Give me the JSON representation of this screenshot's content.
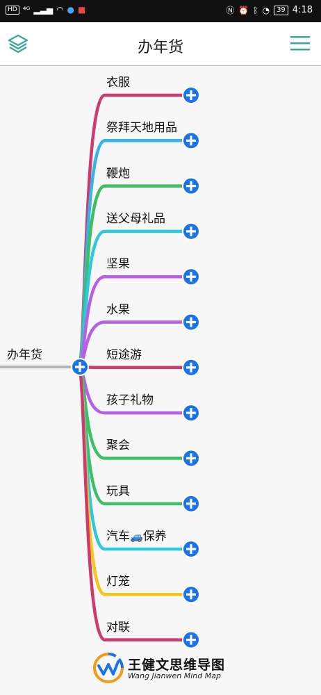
{
  "status_bar": {
    "left_indicators": [
      "HD",
      "4G",
      "signal",
      "wifi",
      "app-notification",
      "app-notification-2"
    ],
    "battery": "39",
    "time": "4:18"
  },
  "app_bar": {
    "title": "办年货",
    "left_icon": "layers-icon",
    "right_icon": "menu-icon"
  },
  "mindmap": {
    "root": {
      "label": "办年货",
      "color": "#b5b5b5"
    },
    "branches": [
      {
        "label": "衣服",
        "color": "#cc3b6e"
      },
      {
        "label": "祭拜天地用品",
        "color": "#36b4ea"
      },
      {
        "label": "鞭炮",
        "color": "#3fbf63"
      },
      {
        "label": "送父母礼品",
        "color": "#2ec9df"
      },
      {
        "label": "坚果",
        "color": "#b760e6"
      },
      {
        "label": "水果",
        "color": "#b760e6"
      },
      {
        "label": "短途游",
        "color": "#cc3b6e"
      },
      {
        "label": "孩子礼物",
        "color": "#b760e6"
      },
      {
        "label": "聚会",
        "color": "#3fbf63"
      },
      {
        "label": "玩具",
        "color": "#3fbf63"
      },
      {
        "label": "汽车",
        "label_suffix": "保养",
        "emoji": "🚙",
        "color": "#2ec9df"
      },
      {
        "label": "灯笼",
        "color": "#f5c518"
      },
      {
        "label": "对联",
        "color": "#cc3b6e"
      }
    ],
    "plus_color": "#1a73e8"
  },
  "watermark": {
    "title": "王健文思维导图",
    "subtitle": "Wang Jianwen Mind Map",
    "logo_colors": [
      "#f39c12",
      "#1a73e8"
    ]
  }
}
